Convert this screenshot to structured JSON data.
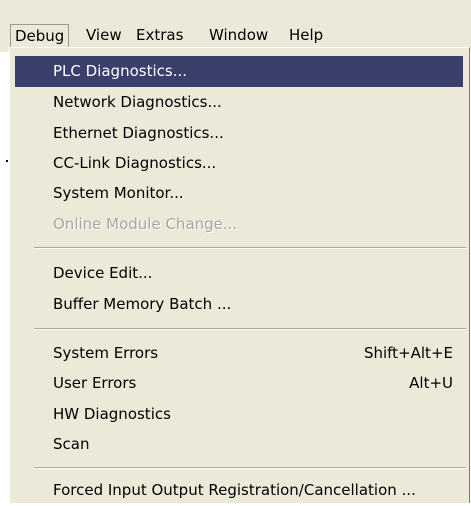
{
  "menubar": {
    "items": [
      {
        "label": "Debug"
      },
      {
        "label": "View"
      },
      {
        "label": "Extras"
      },
      {
        "label": "Window"
      },
      {
        "label": "Help"
      }
    ]
  },
  "debug_menu": {
    "items": [
      {
        "label": "PLC Diagnostics...",
        "state": "highlighted"
      },
      {
        "label": "Network Diagnostics..."
      },
      {
        "label": "Ethernet Diagnostics..."
      },
      {
        "label": "CC-Link Diagnostics..."
      },
      {
        "label": "System Monitor..."
      },
      {
        "label": "Online Module Change...",
        "state": "disabled"
      },
      {
        "label": "Device Edit..."
      },
      {
        "label": "Buffer Memory Batch ..."
      },
      {
        "label": "System Errors",
        "shortcut": "Shift+Alt+E"
      },
      {
        "label": "User Errors",
        "shortcut": "Alt+U"
      },
      {
        "label": "HW Diagnostics"
      },
      {
        "label": "Scan"
      },
      {
        "label": "Forced Input Output Registration/Cancellation ..."
      }
    ]
  },
  "colors": {
    "menu_background": "#ece9d8",
    "highlight": "#3a3f6b",
    "disabled_text": "#a7a6a0"
  }
}
